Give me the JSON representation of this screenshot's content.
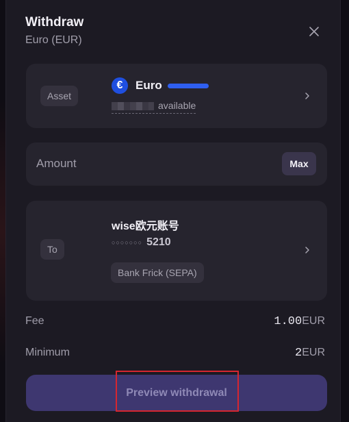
{
  "header": {
    "title": "Withdraw",
    "subtitle": "Euro (EUR)"
  },
  "asset": {
    "pill_label": "Asset",
    "icon_glyph": "€",
    "name": "Euro",
    "available_suffix": "available",
    "accent_color": "#2f5ff0"
  },
  "amount": {
    "placeholder": "Amount",
    "max_label": "Max"
  },
  "destination": {
    "pill_label": "To",
    "account_name": "wise欧元账号",
    "masked_dots": "○○○○○○○",
    "last_digits": "5210",
    "bank": "Bank Frick (SEPA)"
  },
  "fee": {
    "label": "Fee",
    "value": "1.00",
    "unit": "EUR"
  },
  "minimum": {
    "label": "Minimum",
    "value": "2",
    "unit": "EUR"
  },
  "action": {
    "preview_label": "Preview withdrawal",
    "highlight_color": "#d6262f"
  },
  "icons": [
    "close-icon",
    "euro-icon",
    "chevron-right-icon"
  ]
}
